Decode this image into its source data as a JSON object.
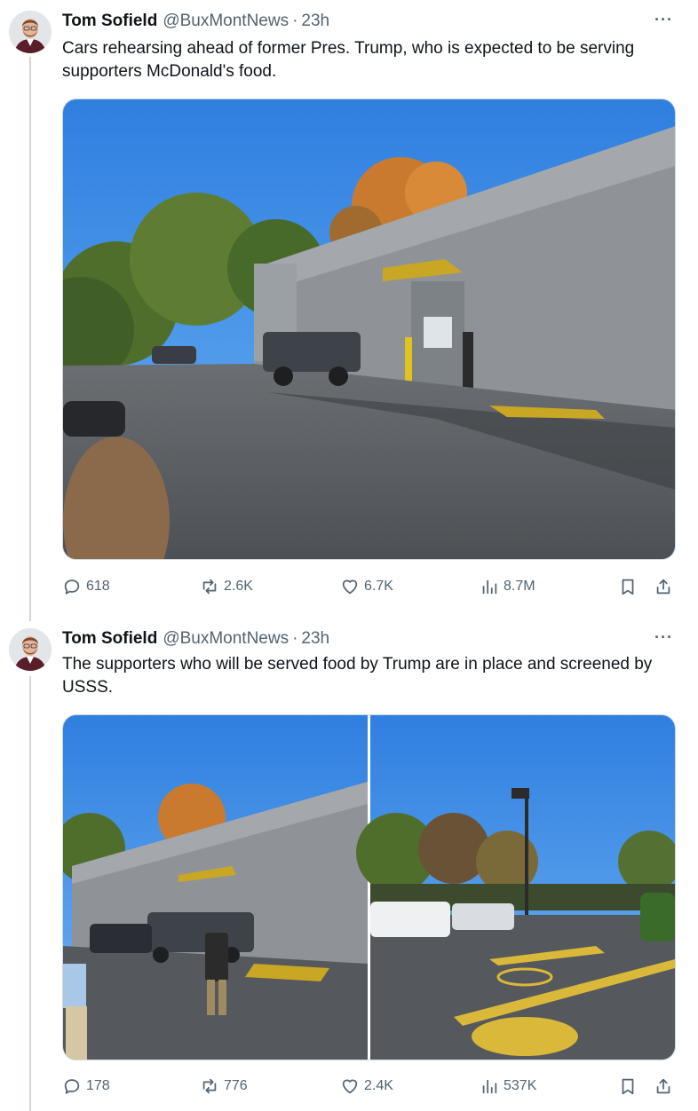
{
  "colors": {
    "text": "#0f1419",
    "secondary": "#536471",
    "border": "#cfd9de",
    "accent": "#1d9bf0"
  },
  "tweets": [
    {
      "author": {
        "name": "Tom Sofield",
        "handle": "@BuxMontNews",
        "time": "23h"
      },
      "text": "Cars rehearsing ahead of former Pres. Trump, who is expected to be serving supporters McDonald's food.",
      "media": {
        "images": [
          "photo"
        ]
      },
      "stats": {
        "replies": "618",
        "reposts": "2.6K",
        "likes": "6.7K",
        "views": "8.7M"
      }
    },
    {
      "author": {
        "name": "Tom Sofield",
        "handle": "@BuxMontNews",
        "time": "23h"
      },
      "text": "The supporters who will be served food by Trump are in place and screened by USSS.",
      "media": {
        "images": [
          "photo",
          "photo"
        ]
      },
      "stats": {
        "replies": "178",
        "reposts": "776",
        "likes": "2.4K",
        "views": "537K"
      }
    }
  ],
  "icons": {
    "more": "more-icon",
    "reply": "reply-icon",
    "repost": "repost-icon",
    "like": "heart-icon",
    "views": "views-icon",
    "bookmark": "bookmark-icon",
    "share": "share-icon"
  }
}
